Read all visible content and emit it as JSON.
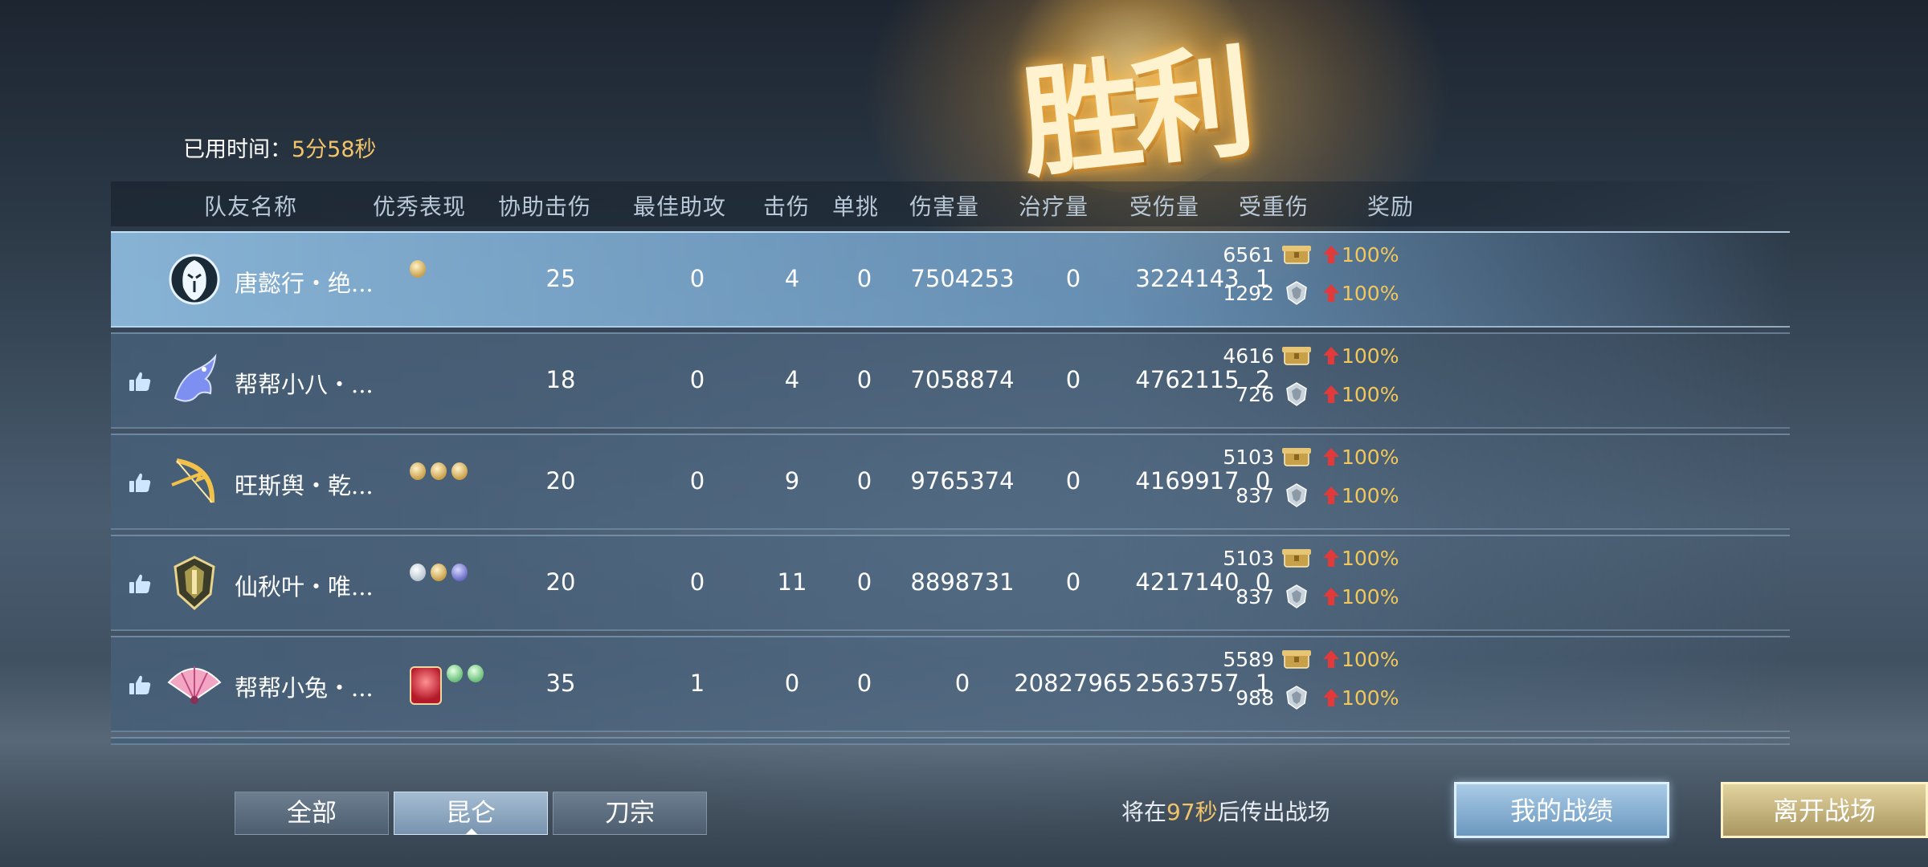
{
  "banner": {
    "title": "胜利"
  },
  "time": {
    "label": "已用时间：",
    "value": "5分58秒"
  },
  "columns": [
    "队友名称",
    "优秀表现",
    "协助击伤",
    "最佳助攻",
    "击伤",
    "单挑",
    "伤害量",
    "治疗量",
    "受伤量",
    "受重伤",
    "奖励"
  ],
  "rows": [
    {
      "name": "唐懿行・绝...",
      "is_self": true,
      "class_icon": "white-mask-icon",
      "badges": [
        "feather"
      ],
      "assist": "25",
      "best_assist": "0",
      "kills": "4",
      "duel": "0",
      "damage": "7504253",
      "healing": "0",
      "taken": "3224143",
      "downed": "1",
      "reward1": {
        "amount": "6561",
        "bonus": "100%"
      },
      "reward2": {
        "amount": "1292",
        "bonus": "100%"
      }
    },
    {
      "name": "帮帮小八・...",
      "is_self": false,
      "class_icon": "blue-dragon-icon",
      "badges": [],
      "assist": "18",
      "best_assist": "0",
      "kills": "4",
      "duel": "0",
      "damage": "7058874",
      "healing": "0",
      "taken": "4762115",
      "downed": "2",
      "reward1": {
        "amount": "4616",
        "bonus": "100%"
      },
      "reward2": {
        "amount": "726",
        "bonus": "100%"
      }
    },
    {
      "name": "旺斯舆・乾...",
      "is_self": false,
      "class_icon": "golden-bow-icon",
      "badges": [
        "gold",
        "gold",
        "gold"
      ],
      "assist": "20",
      "best_assist": "0",
      "kills": "9",
      "duel": "0",
      "damage": "9765374",
      "healing": "0",
      "taken": "4169917",
      "downed": "0",
      "reward1": {
        "amount": "5103",
        "bonus": "100%"
      },
      "reward2": {
        "amount": "837",
        "bonus": "100%"
      }
    },
    {
      "name": "仙秋叶・唯...",
      "is_self": false,
      "class_icon": "shield-crest-icon",
      "badges": [
        "white",
        "gold",
        "purple"
      ],
      "assist": "20",
      "best_assist": "0",
      "kills": "11",
      "duel": "0",
      "damage": "8898731",
      "healing": "0",
      "taken": "4217140",
      "downed": "0",
      "reward1": {
        "amount": "5103",
        "bonus": "100%"
      },
      "reward2": {
        "amount": "837",
        "bonus": "100%"
      }
    },
    {
      "name": "帮帮小兔・...",
      "is_self": false,
      "class_icon": "pink-fan-icon",
      "badges": [
        "big",
        "green",
        "green"
      ],
      "assist": "35",
      "best_assist": "1",
      "kills": "0",
      "duel": "0",
      "damage": "0",
      "healing": "20827965",
      "taken": "2563757",
      "downed": "1",
      "reward1": {
        "amount": "5589",
        "bonus": "100%"
      },
      "reward2": {
        "amount": "988",
        "bonus": "100%"
      }
    }
  ],
  "tabs": [
    {
      "label": "全部",
      "active": false
    },
    {
      "label": "昆仑",
      "active": true
    },
    {
      "label": "刀宗",
      "active": false
    }
  ],
  "countdown": {
    "prefix": "将在",
    "seconds": "97秒",
    "suffix": "后传出战场"
  },
  "buttons": {
    "record": "我的战绩",
    "leave": "离开战场"
  },
  "colors": {
    "accent_gold": "#f2c46a",
    "bonus": "#f3c85a",
    "arrow_red": "#e23a3a"
  }
}
